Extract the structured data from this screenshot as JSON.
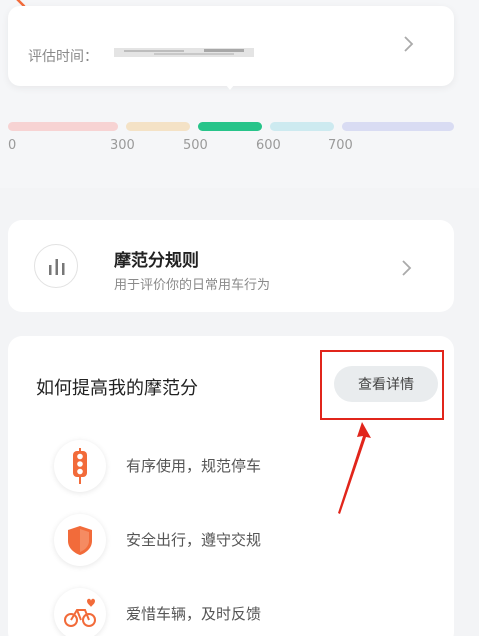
{
  "score_card": {
    "eval_label": "评估时间：",
    "eval_value": ""
  },
  "scale": {
    "ticks": [
      "0",
      "300",
      "500",
      "600",
      "700"
    ],
    "colors": [
      "#f7d3d3",
      "#f4e2c6",
      "#27c48a",
      "#cdeaf0",
      "#d9dcf3"
    ]
  },
  "rule_card": {
    "title": "摩范分规则",
    "subtitle": "用于评价你的日常用车行为"
  },
  "improve": {
    "title": "如何提高我的摩范分",
    "detail_button": "查看详情",
    "tips": [
      {
        "icon": "traffic-light-icon",
        "text": "有序使用，规范停车"
      },
      {
        "icon": "shield-icon",
        "text": "安全出行，遵守交规"
      },
      {
        "icon": "bicycle-heart-icon",
        "text": "爱惜车辆，及时反馈"
      }
    ]
  },
  "colors": {
    "annotation_red": "#e1251b",
    "accent_orange": "#f26b3a",
    "accent_green": "#27c48a"
  }
}
